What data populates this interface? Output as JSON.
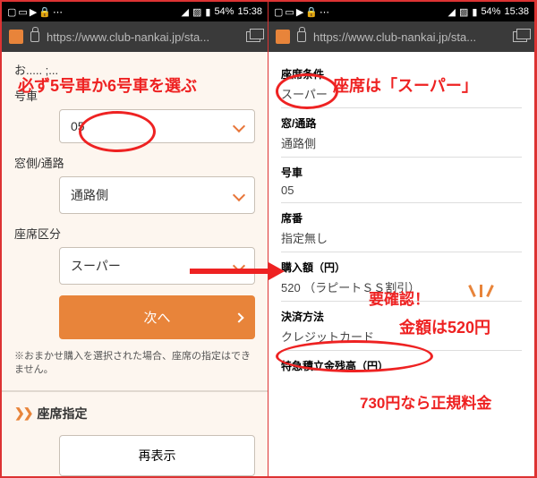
{
  "status": {
    "battery": "54%",
    "time": "15:38"
  },
  "browser": {
    "url": "https://www.club-nankai.jp/sta..."
  },
  "left": {
    "top_partial": "お.....  ;...",
    "car_label": "号車",
    "car_value": "05",
    "side_label": "窓側/通路",
    "side_value": "通路側",
    "class_label": "座席区分",
    "class_value": "スーパー",
    "next": "次へ",
    "note": "※おまかせ購入を選択された場合、座席の指定はできません。",
    "seat_section": "座席指定",
    "redisplay": "再表示"
  },
  "right": {
    "cond_label": "座席条件",
    "cond_value": "スーパー",
    "side_label": "窓/通路",
    "side_value": "通路側",
    "car_label": "号車",
    "car_value": "05",
    "seat_label": "席番",
    "seat_value": "指定無し",
    "amount_label": "購入額（円）",
    "amount_value": "520 （ラピートＳＳ割引）",
    "pay_label": "決済方法",
    "pay_value": "クレジットカード",
    "balance_label": "特急積立金残高（円）"
  },
  "annotations": {
    "a1": "必ず5号車か6号車を選ぶ",
    "a2": "座席は「スーパー」",
    "a3": "要確認！",
    "a4": "金額は520円",
    "a5": "730円なら正規料金"
  }
}
